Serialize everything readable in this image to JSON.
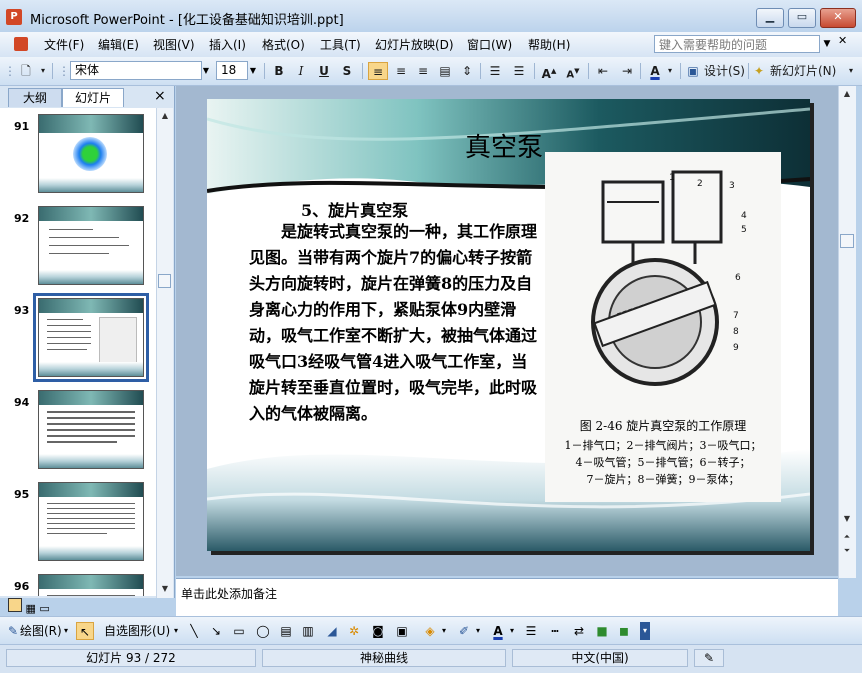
{
  "window": {
    "title": "Microsoft PowerPoint - [化工设备基础知识培训.ppt]",
    "app_icon": "powerpoint-icon"
  },
  "menu": {
    "items": [
      "文件(F)",
      "编辑(E)",
      "视图(V)",
      "插入(I)",
      "格式(O)",
      "工具(T)",
      "幻灯片放映(D)",
      "窗口(W)",
      "帮助(H)"
    ],
    "help_placeholder": "键入需要帮助的问题"
  },
  "toolbar": {
    "font": "宋体",
    "size": "18",
    "bold": "B",
    "italic": "I",
    "underline": "U",
    "shadow": "S",
    "font_color": "A",
    "design_label": "设计(S)",
    "new_slide_label": "新幻灯片(N)"
  },
  "panel": {
    "tab_outline": "大纲",
    "tab_slides": "幻灯片",
    "close": "×",
    "slides": [
      {
        "num": "91"
      },
      {
        "num": "92"
      },
      {
        "num": "93",
        "selected": true
      },
      {
        "num": "94"
      },
      {
        "num": "95"
      },
      {
        "num": "96"
      }
    ]
  },
  "slide": {
    "title": "真空泵",
    "subtitle": "5、旋片真空泵",
    "body": "是旋转式真空泵的一种，其工作原理见图。当带有两个旋片7的偏心转子按箭头方向旋转时，旋片在弹簧8的压力及自身离心力的作用下，紧贴泵体9内壁滑动，吸气工作室不断扩大，被抽气体通过吸气口3经吸气管4进入吸气工作室，当旋片转至垂直位置时，吸气完毕，此时吸入的气体被隔离。",
    "figure_caption_1": "图 2-46   旋片真空泵的工作原理",
    "figure_caption_2": "1－排气口；2－排气阀片；3－吸气口；",
    "figure_caption_3": "4－吸气管；5－排气管；6－转子；",
    "figure_caption_4": "7－旋片；8－弹簧；9－泵体；",
    "figure_labels": [
      "1",
      "2",
      "3",
      "4",
      "5",
      "6",
      "7",
      "8",
      "9"
    ]
  },
  "notes": {
    "placeholder": "单击此处添加备注"
  },
  "drawbar": {
    "draw_label": "绘图(R)",
    "autoshape_label": "自选图形(U)"
  },
  "status": {
    "slide": "幻灯片 93 / 272",
    "design": "神秘曲线",
    "language": "中文(中国)"
  }
}
